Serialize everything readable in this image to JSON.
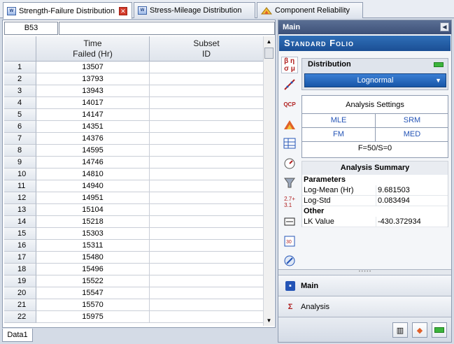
{
  "tabs": [
    {
      "label": "Strength-Failure Distribution",
      "active": true
    },
    {
      "label": "Stress-Mileage Distribution",
      "active": false
    },
    {
      "label": "Component Reliability",
      "active": false
    }
  ],
  "sheet": {
    "cell_ref": "B53",
    "columns": [
      {
        "line1": "Time",
        "line2": "Failed (Hr)"
      },
      {
        "line1": "Subset",
        "line2": "ID"
      }
    ],
    "rows": [
      {
        "n": "1",
        "time": "13507"
      },
      {
        "n": "2",
        "time": "13793"
      },
      {
        "n": "3",
        "time": "13943"
      },
      {
        "n": "4",
        "time": "14017"
      },
      {
        "n": "5",
        "time": "14147"
      },
      {
        "n": "6",
        "time": "14351"
      },
      {
        "n": "7",
        "time": "14376"
      },
      {
        "n": "8",
        "time": "14595"
      },
      {
        "n": "9",
        "time": "14746"
      },
      {
        "n": "10",
        "time": "14810"
      },
      {
        "n": "11",
        "time": "14940"
      },
      {
        "n": "12",
        "time": "14951"
      },
      {
        "n": "13",
        "time": "15104"
      },
      {
        "n": "14",
        "time": "15218"
      },
      {
        "n": "15",
        "time": "15303"
      },
      {
        "n": "16",
        "time": "15311"
      },
      {
        "n": "17",
        "time": "15480"
      },
      {
        "n": "18",
        "time": "15496"
      },
      {
        "n": "19",
        "time": "15522"
      },
      {
        "n": "20",
        "time": "15547"
      },
      {
        "n": "21",
        "time": "15570"
      },
      {
        "n": "22",
        "time": "15975"
      }
    ],
    "sheet_tab": "Data1"
  },
  "panel": {
    "title": "Main",
    "folio": "Standard Folio",
    "distribution_label": "Distribution",
    "distribution_value": "Lognormal",
    "analysis_settings": "Analysis Settings",
    "mle": "MLE",
    "srm": "SRM",
    "fm": "FM",
    "med": "MED",
    "fs": "F=50/S=0",
    "summary_title": "Analysis Summary",
    "parameters": "Parameters",
    "log_mean_label": "Log-Mean (Hr)",
    "log_mean_value": "9.681503",
    "log_std_label": "Log-Std",
    "log_std_value": "0.083494",
    "other": "Other",
    "lk_label": "LK Value",
    "lk_value": "-430.372934",
    "nav_main": "Main",
    "nav_analysis": "Analysis"
  },
  "colors": {
    "accent": "#1b4f95",
    "link": "#2454b6",
    "active_green": "#3cb43c"
  }
}
